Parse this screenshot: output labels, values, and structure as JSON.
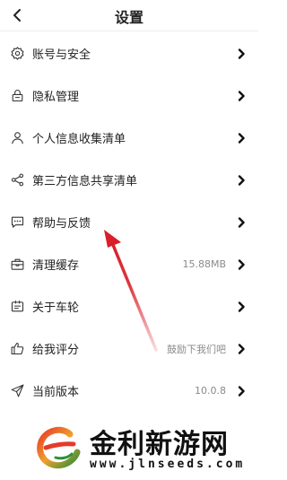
{
  "header": {
    "title": "设置"
  },
  "settings": [
    {
      "label": "账号与安全",
      "value": "",
      "icon": "gear-icon"
    },
    {
      "label": "隐私管理",
      "value": "",
      "icon": "lock-icon"
    },
    {
      "label": "个人信息收集清单",
      "value": "",
      "icon": "person-icon"
    },
    {
      "label": "第三方信息共享清单",
      "value": "",
      "icon": "share-icon"
    },
    {
      "label": "帮助与反馈",
      "value": "",
      "icon": "chat-bubble-icon"
    },
    {
      "label": "清理缓存",
      "value": "15.88MB",
      "icon": "toolbox-icon"
    },
    {
      "label": "关于车轮",
      "value": "",
      "icon": "info-card-icon"
    },
    {
      "label": "给我评分",
      "value": "鼓励下我们吧",
      "icon": "thumbs-up-icon"
    },
    {
      "label": "当前版本",
      "value": "10.0.8",
      "icon": "send-icon"
    }
  ],
  "annotation": {
    "color": "#d81f2a",
    "target": "帮助与反馈"
  },
  "watermark": {
    "name": "金利新游网",
    "url": "www.jlnseeds.com"
  }
}
